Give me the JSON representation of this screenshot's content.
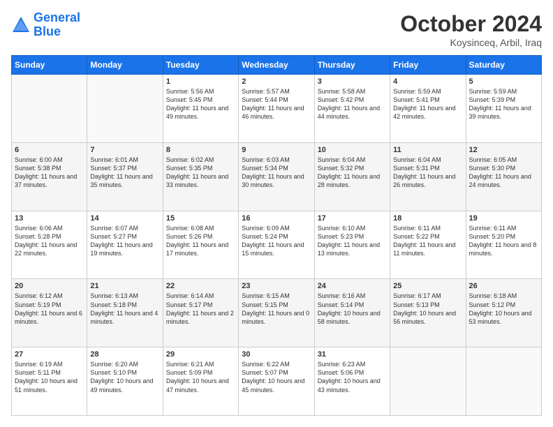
{
  "logo": {
    "line1": "General",
    "line2": "Blue"
  },
  "title": "October 2024",
  "location": "Koysinceq, Arbil, Iraq",
  "days_header": [
    "Sunday",
    "Monday",
    "Tuesday",
    "Wednesday",
    "Thursday",
    "Friday",
    "Saturday"
  ],
  "weeks": [
    [
      {
        "day": "",
        "content": ""
      },
      {
        "day": "",
        "content": ""
      },
      {
        "day": "1",
        "content": "Sunrise: 5:56 AM\nSunset: 5:45 PM\nDaylight: 11 hours and 49 minutes."
      },
      {
        "day": "2",
        "content": "Sunrise: 5:57 AM\nSunset: 5:44 PM\nDaylight: 11 hours and 46 minutes."
      },
      {
        "day": "3",
        "content": "Sunrise: 5:58 AM\nSunset: 5:42 PM\nDaylight: 11 hours and 44 minutes."
      },
      {
        "day": "4",
        "content": "Sunrise: 5:59 AM\nSunset: 5:41 PM\nDaylight: 11 hours and 42 minutes."
      },
      {
        "day": "5",
        "content": "Sunrise: 5:59 AM\nSunset: 5:39 PM\nDaylight: 11 hours and 39 minutes."
      }
    ],
    [
      {
        "day": "6",
        "content": "Sunrise: 6:00 AM\nSunset: 5:38 PM\nDaylight: 11 hours and 37 minutes."
      },
      {
        "day": "7",
        "content": "Sunrise: 6:01 AM\nSunset: 5:37 PM\nDaylight: 11 hours and 35 minutes."
      },
      {
        "day": "8",
        "content": "Sunrise: 6:02 AM\nSunset: 5:35 PM\nDaylight: 11 hours and 33 minutes."
      },
      {
        "day": "9",
        "content": "Sunrise: 6:03 AM\nSunset: 5:34 PM\nDaylight: 11 hours and 30 minutes."
      },
      {
        "day": "10",
        "content": "Sunrise: 6:04 AM\nSunset: 5:32 PM\nDaylight: 11 hours and 28 minutes."
      },
      {
        "day": "11",
        "content": "Sunrise: 6:04 AM\nSunset: 5:31 PM\nDaylight: 11 hours and 26 minutes."
      },
      {
        "day": "12",
        "content": "Sunrise: 6:05 AM\nSunset: 5:30 PM\nDaylight: 11 hours and 24 minutes."
      }
    ],
    [
      {
        "day": "13",
        "content": "Sunrise: 6:06 AM\nSunset: 5:28 PM\nDaylight: 11 hours and 22 minutes."
      },
      {
        "day": "14",
        "content": "Sunrise: 6:07 AM\nSunset: 5:27 PM\nDaylight: 11 hours and 19 minutes."
      },
      {
        "day": "15",
        "content": "Sunrise: 6:08 AM\nSunset: 5:26 PM\nDaylight: 11 hours and 17 minutes."
      },
      {
        "day": "16",
        "content": "Sunrise: 6:09 AM\nSunset: 5:24 PM\nDaylight: 11 hours and 15 minutes."
      },
      {
        "day": "17",
        "content": "Sunrise: 6:10 AM\nSunset: 5:23 PM\nDaylight: 11 hours and 13 minutes."
      },
      {
        "day": "18",
        "content": "Sunrise: 6:11 AM\nSunset: 5:22 PM\nDaylight: 11 hours and 11 minutes."
      },
      {
        "day": "19",
        "content": "Sunrise: 6:11 AM\nSunset: 5:20 PM\nDaylight: 11 hours and 8 minutes."
      }
    ],
    [
      {
        "day": "20",
        "content": "Sunrise: 6:12 AM\nSunset: 5:19 PM\nDaylight: 11 hours and 6 minutes."
      },
      {
        "day": "21",
        "content": "Sunrise: 6:13 AM\nSunset: 5:18 PM\nDaylight: 11 hours and 4 minutes."
      },
      {
        "day": "22",
        "content": "Sunrise: 6:14 AM\nSunset: 5:17 PM\nDaylight: 11 hours and 2 minutes."
      },
      {
        "day": "23",
        "content": "Sunrise: 6:15 AM\nSunset: 5:15 PM\nDaylight: 11 hours and 0 minutes."
      },
      {
        "day": "24",
        "content": "Sunrise: 6:16 AM\nSunset: 5:14 PM\nDaylight: 10 hours and 58 minutes."
      },
      {
        "day": "25",
        "content": "Sunrise: 6:17 AM\nSunset: 5:13 PM\nDaylight: 10 hours and 56 minutes."
      },
      {
        "day": "26",
        "content": "Sunrise: 6:18 AM\nSunset: 5:12 PM\nDaylight: 10 hours and 53 minutes."
      }
    ],
    [
      {
        "day": "27",
        "content": "Sunrise: 6:19 AM\nSunset: 5:11 PM\nDaylight: 10 hours and 51 minutes."
      },
      {
        "day": "28",
        "content": "Sunrise: 6:20 AM\nSunset: 5:10 PM\nDaylight: 10 hours and 49 minutes."
      },
      {
        "day": "29",
        "content": "Sunrise: 6:21 AM\nSunset: 5:09 PM\nDaylight: 10 hours and 47 minutes."
      },
      {
        "day": "30",
        "content": "Sunrise: 6:22 AM\nSunset: 5:07 PM\nDaylight: 10 hours and 45 minutes."
      },
      {
        "day": "31",
        "content": "Sunrise: 6:23 AM\nSunset: 5:06 PM\nDaylight: 10 hours and 43 minutes."
      },
      {
        "day": "",
        "content": ""
      },
      {
        "day": "",
        "content": ""
      }
    ]
  ]
}
